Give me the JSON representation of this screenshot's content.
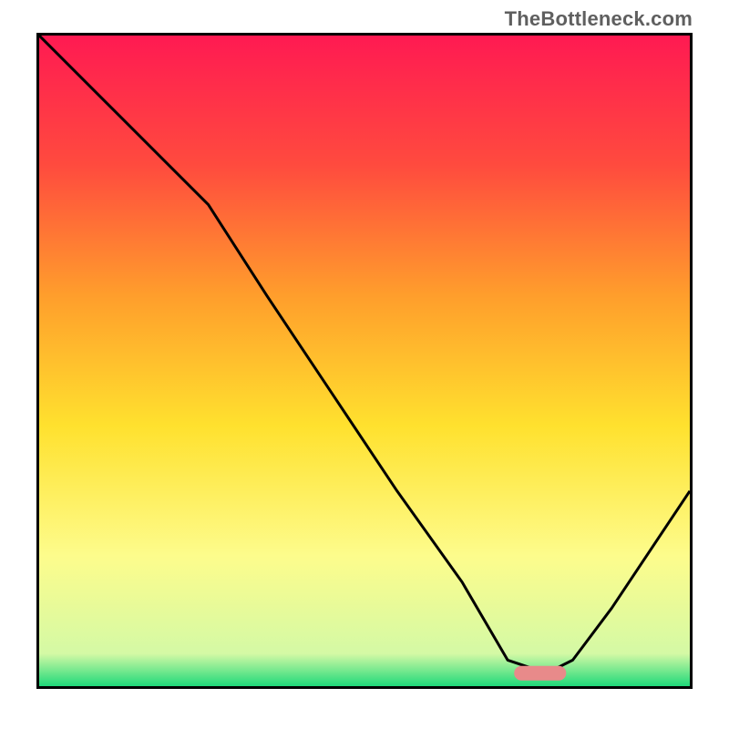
{
  "watermark": "TheBottleneck.com",
  "chart_data": {
    "type": "line",
    "title": "",
    "xlabel": "",
    "ylabel": "",
    "xlim": [
      0,
      100
    ],
    "ylim": [
      0,
      100
    ],
    "grid": false,
    "legend": false,
    "gradient_stops": [
      {
        "pct": 0,
        "color": "#ff1a52"
      },
      {
        "pct": 20,
        "color": "#ff4b3e"
      },
      {
        "pct": 40,
        "color": "#ff9e2c"
      },
      {
        "pct": 60,
        "color": "#ffe12e"
      },
      {
        "pct": 80,
        "color": "#fdfc8c"
      },
      {
        "pct": 95,
        "color": "#d4f9a5"
      },
      {
        "pct": 100,
        "color": "#1fd97a"
      }
    ],
    "series": [
      {
        "name": "bottleneck-curve",
        "color": "#000000",
        "x": [
          0,
          10,
          20,
          26,
          35,
          45,
          55,
          65,
          72,
          78,
          82,
          88,
          100
        ],
        "y": [
          100,
          90,
          80,
          74,
          60,
          45,
          30,
          16,
          4,
          2,
          4,
          12,
          30
        ]
      }
    ],
    "marker": {
      "name": "optimal-range",
      "x_start": 73,
      "x_end": 81,
      "y": 2,
      "color": "#e88a8a"
    }
  }
}
